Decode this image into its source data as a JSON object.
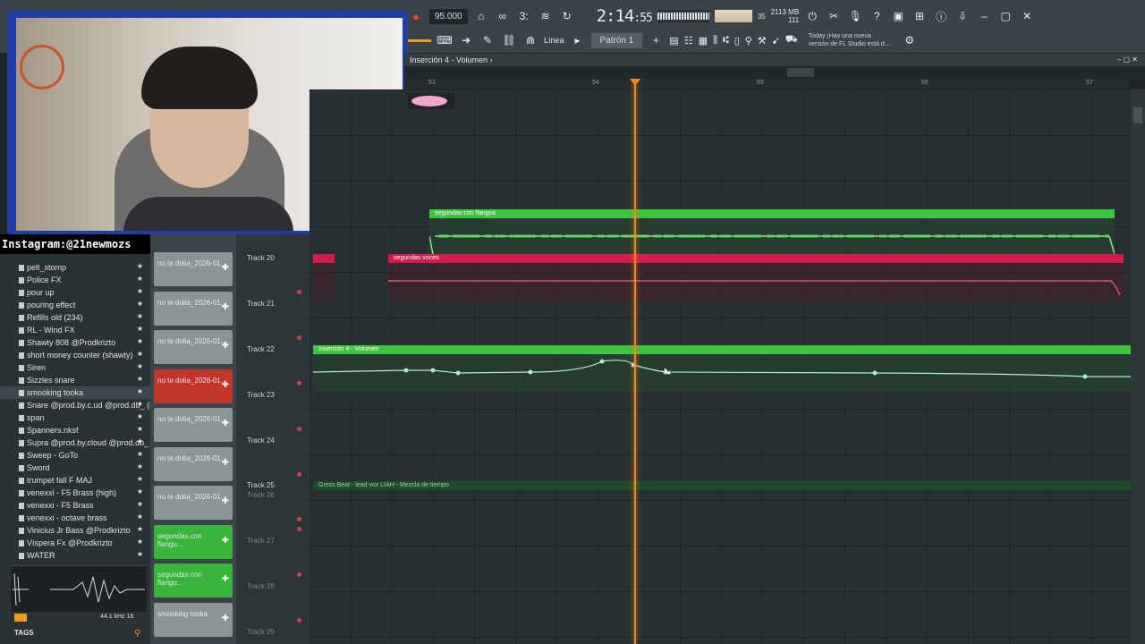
{
  "toolbar": {
    "tempo": "95.000",
    "time_main": "2:14",
    "time_sub": ":55",
    "memory_top": "2113 MB",
    "memory_bottom": "111",
    "cpu": "35",
    "pattern": "Patrón 1",
    "snap": "Línea",
    "news_line1": "Today  ¡Hay una nueva",
    "news_line2": "versión de FL Studio está d..."
  },
  "webcam": {
    "overlay_text": "Instagram:@21newmozs"
  },
  "browser": {
    "items": [
      {
        "label": "pelt_stomp"
      },
      {
        "label": "Police FX"
      },
      {
        "label": "pour up"
      },
      {
        "label": "pouring effect"
      },
      {
        "label": "Refills old (234)"
      },
      {
        "label": "RL - Wind FX"
      },
      {
        "label": "Shawty 808 @Prodkrizto"
      },
      {
        "label": "short money counter (shawty)"
      },
      {
        "label": "Siren"
      },
      {
        "label": "Sizzles snare"
      },
      {
        "label": "smooking tooka"
      },
      {
        "label": "Snare @prod.by.c.ud @prod.db_ (8)"
      },
      {
        "label": "span"
      },
      {
        "label": "Spanners.nksf"
      },
      {
        "label": "Supra @prod.by.cloud @prod.db_"
      },
      {
        "label": "Sweep - GoTo"
      },
      {
        "label": "Sword"
      },
      {
        "label": "trumpet fall F MAJ"
      },
      {
        "label": "venexxi - F5 Brass (high)"
      },
      {
        "label": "venexxi - F5 Brass"
      },
      {
        "label": "venexxi - octave brass"
      },
      {
        "label": "Vinicius Jr Bass @Prodkrizto"
      },
      {
        "label": "Víspera Fx @Prodkrizto"
      },
      {
        "label": "WATER"
      }
    ],
    "sample_rate": "44.1 kHz 16",
    "tags_label": "TAGS"
  },
  "clips": [
    {
      "label": "no te dolia_2026-01..."
    },
    {
      "label": "no te dolia_2026-01..."
    },
    {
      "label": "no te dolia_2026-01..."
    },
    {
      "label": "no te dolia_2026-01..."
    },
    {
      "label": "no te dolia_2026-01..."
    },
    {
      "label": "no te dolia_2026-01..."
    },
    {
      "label": "no te dolia_2026-01..."
    },
    {
      "label": "segundas con flangu..."
    },
    {
      "label": "segundas con flangu..."
    },
    {
      "label": "smooking tooka"
    }
  ],
  "tracks": [
    {
      "name": "Track 20"
    },
    {
      "name": "Track 21"
    },
    {
      "name": "Track 22"
    },
    {
      "name": "Track 23"
    },
    {
      "name": "Track 24"
    },
    {
      "name": "Track 25"
    },
    {
      "name": "Track 26"
    },
    {
      "name": "Track 27"
    },
    {
      "name": "Track 28"
    },
    {
      "name": "Track 29"
    }
  ],
  "playlist": {
    "title": "Inserción 4 - Volumen",
    "bars": [
      "53",
      "54",
      "55",
      "56",
      "57"
    ],
    "clip_segundas_flangus": "segundas con flangus",
    "clip_segundas_voces": "segundas voces",
    "clip_automation": "Inserción 4 - Volumen",
    "clip_grossbeat": "Gross Beat - lead vox LIAH - Mezcla de tiempo"
  },
  "colors": {
    "playhead": "#f08a1c",
    "green_clip": "#3ec43f",
    "red_clip": "#d21c4c",
    "webcam_border": "#1f3fa6"
  }
}
